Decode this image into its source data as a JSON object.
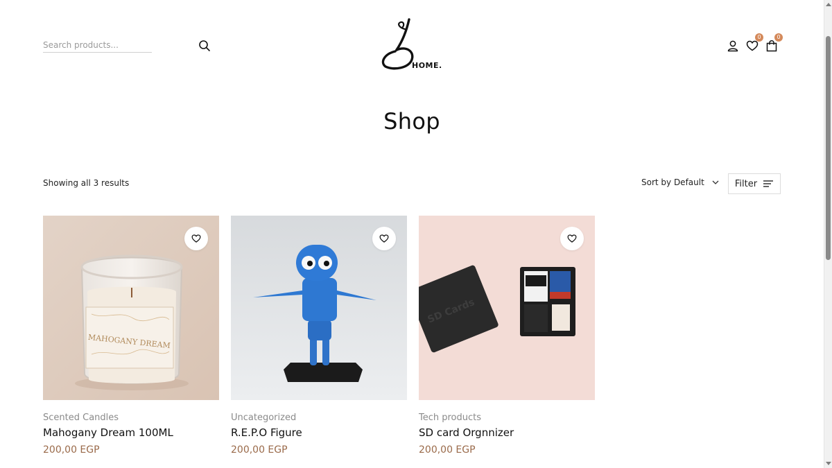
{
  "header": {
    "search": {
      "placeholder": "Search products..."
    },
    "logo_text": "HOME.",
    "wishlist_count": "0",
    "cart_count": "0"
  },
  "page": {
    "title": "Shop",
    "results_text": "Showing all 3 results",
    "sort_label": "Sort by Default",
    "filter_label": "Filter"
  },
  "products": [
    {
      "category": "Scented Candles",
      "name": "Mahogany Dream 100ML",
      "price": "200,00 EGP",
      "image_text": "MAHOGANY DREAM"
    },
    {
      "category": "Uncategorized",
      "name": "R.E.P.O Figure",
      "price": "200,00 EGP"
    },
    {
      "category": "Tech products",
      "name": "SD card Orgnnizer",
      "price": "200,00 EGP",
      "image_text": "SD Cards"
    }
  ],
  "colors": {
    "accent": "#d4895a",
    "price": "#9a6a4a"
  },
  "icons": [
    "search-icon",
    "user-icon",
    "heart-icon",
    "bag-icon",
    "chevron-down-icon",
    "filter-lines-icon"
  ]
}
